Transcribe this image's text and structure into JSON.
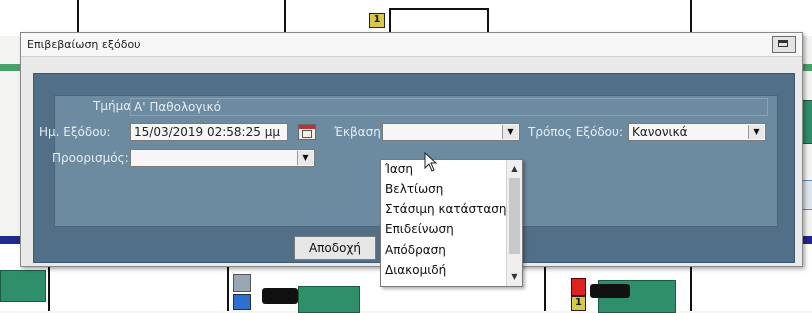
{
  "background": {
    "badge_left": "1",
    "badge_right": "1"
  },
  "dialog": {
    "title": "Επιβεβαίωση εξόδου",
    "restore_icon": "window-restore-icon",
    "fields": {
      "department_label": "Τμήμα:",
      "department_value": "Α' Παθολογικό",
      "exit_date_label": "Ημ. Εξόδου:",
      "exit_date_value": "15/03/2019 02:58:25 μμ",
      "outcome_label": "Έκβαση:",
      "outcome_value": "",
      "exit_mode_label": "Τρόπος Εξόδου:",
      "exit_mode_value": "Κανονικά",
      "destination_label": "Προορισμός:",
      "destination_value": ""
    },
    "accept_button": "Αποδοχή"
  },
  "outcome_dropdown": {
    "options": [
      "Ίαση",
      "Βελτίωση",
      "Στάσιμη κατάσταση",
      "Επιδείνωση",
      "Απόδραση",
      "Διακομιδή"
    ]
  }
}
